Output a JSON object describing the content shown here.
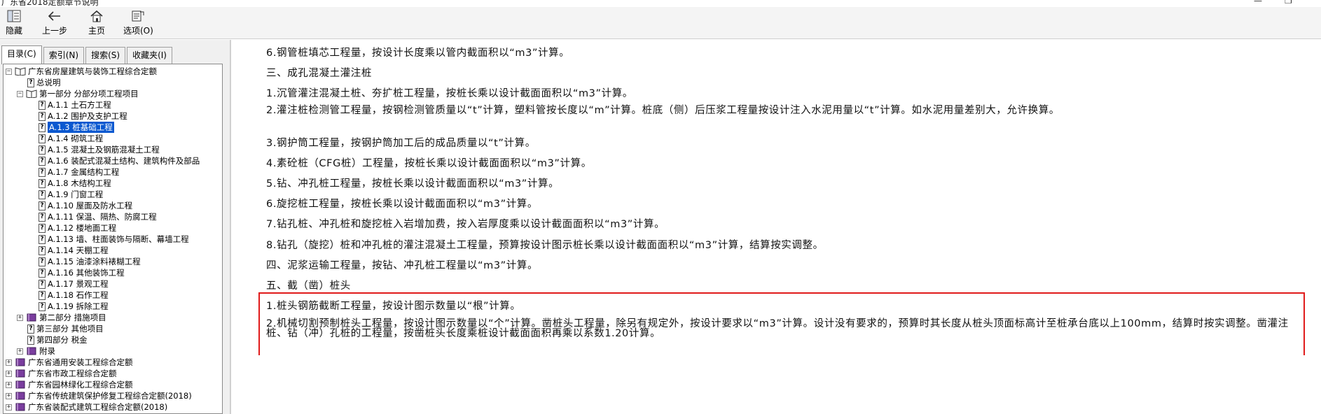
{
  "window": {
    "title": "广东省2018定额章节说明",
    "min": "—",
    "max": "❐"
  },
  "toolbar": {
    "hide": "隐藏",
    "back": "上一步",
    "home": "主页",
    "options": "选项(O)"
  },
  "tabs": [
    "目录(C)",
    "索引(N)",
    "搜索(S)",
    "收藏夹(I)"
  ],
  "tree": {
    "root1": "广东省房屋建筑与装饰工程综合定额",
    "general": "总说明",
    "part1": "第一部分 分部分项工程项目",
    "items": [
      "A.1.1 土石方工程",
      "A.1.2 围护及支护工程",
      "A.1.3 桩基础工程",
      "A.1.4 砌筑工程",
      "A.1.5 混凝土及钢筋混凝土工程",
      "A.1.6 装配式混凝土结构、建筑构件及部品",
      "A.1.7 金属结构工程",
      "A.1.8 木结构工程",
      "A.1.9 门窗工程",
      "A.1.10 屋面及防水工程",
      "A.1.11 保温、隔热、防腐工程",
      "A.1.12 楼地面工程",
      "A.1.13 墙、柱面装饰与隔断、幕墙工程",
      "A.1.14 天棚工程",
      "A.1.15 油漆涂料裱糊工程",
      "A.1.16 其他装饰工程",
      "A.1.17 景观工程",
      "A.1.18 石作工程",
      "A.1.19 拆除工程"
    ],
    "part2": "第二部分 措施项目",
    "part3": "第三部分 其他项目",
    "part4": "第四部分 税金",
    "appendix": "附录",
    "root2": "广东省通用安装工程综合定额",
    "root3": "广东省市政工程综合定额",
    "root4": "广东省园林绿化工程综合定额",
    "root5": "广东省传统建筑保护修复工程综合定额(2018)",
    "root6": "广东省装配式建筑工程综合定额(2018)"
  },
  "content": {
    "p1": "6.钢管桩填芯工程量，按设计长度乘以管内截面积以“m3”计算。",
    "h3": "三、成孔混凝土灌注桩",
    "p2": "1.沉管灌注混凝土桩、夯扩桩工程量，按桩长乘以设计截面面积以“m3”计算。",
    "p3": "2.灌注桩检测管工程量，按钢检测管质量以“t”计算，塑料管按长度以“m”计算。桩底（侧）后压浆工程量按设计注入水泥用量以“t”计算。如水泥用量差别大，允许换算。",
    "p4": "3.钢护筒工程量，按钢护筒加工后的成品质量以“t”计算。",
    "p5": "4.素砼桩（CFG桩）工程量，按桩长乘以设计截面面积以“m3”计算。",
    "p6": "5.钻、冲孔桩工程量，按桩长乘以设计截面面积以“m3”计算。",
    "p7": "6.旋挖桩工程量，按桩长乘以设计截面面积以“m3”计算。",
    "p8": "7.钻孔桩、冲孔桩和旋挖桩入岩增加费，按入岩厚度乘以设计截面面积以“m3”计算。",
    "p9": "8.钻孔（旋挖）桩和冲孔桩的灌注混凝土工程量，预算按设计图示桩长乘以设计截面面积以“m3”计算，结算按实调整。",
    "h4": "四、泥浆运输工程量，按钻、冲孔桩工程量以“m3”计算。",
    "h5": "五、截（凿）桩头",
    "p10": "1.桩头钢筋截断工程量，按设计图示数量以“根”计算。",
    "p11": "2.机械切割预制桩头工程量，按设计图示数量以“个”计算。凿桩头工程量，除另有规定外，按设计要求以“m3”计算。设计没有要求的，预算时其长度从桩头顶面标高计至桩承台底以上100mm，结算时按实调整。凿灌注桩、钻（冲）孔桩的工程量，按凿桩头长度乘桩设计截面面积再乘以系数1.20计算。"
  }
}
